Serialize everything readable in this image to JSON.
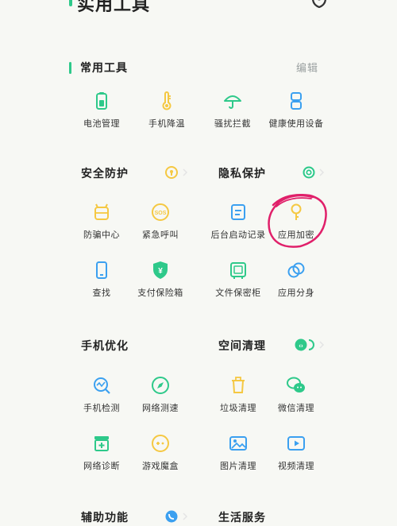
{
  "header": {
    "title": "实用工具"
  },
  "sections": {
    "common": {
      "title": "常用工具",
      "edit_label": "编辑"
    },
    "security": {
      "title": "安全防护"
    },
    "privacy": {
      "title": "隐私保护"
    },
    "optimize": {
      "title": "手机优化"
    },
    "clean": {
      "title": "空间清理"
    },
    "assist": {
      "title": "辅助功能"
    },
    "life": {
      "title": "生活服务"
    }
  },
  "tools": {
    "battery": "电池管理",
    "cooling": "手机降温",
    "block": "骚扰拦截",
    "health": "健康使用设备",
    "antifraud": "防骗中心",
    "sos": "紧急呼叫",
    "bootlog": "后台启动记录",
    "applock": "应用加密",
    "find": "查找",
    "paysafe": "支付保险箱",
    "filesafe": "文件保密柜",
    "clone": "应用分身",
    "check": "手机检测",
    "netspeed": "网络测速",
    "trash": "垃圾清理",
    "wechat": "微信清理",
    "netdiag": "网络诊断",
    "gamebox": "游戏魔盒",
    "photo": "图片清理",
    "video": "视频清理"
  },
  "colors": {
    "accent": "#2ec98a",
    "blue": "#3ba0f0",
    "yellow": "#f5c842",
    "annotation": "#e0206a"
  },
  "icons": {
    "battery": "battery-icon",
    "cooling": "thermometer-icon",
    "block": "umbrella-icon",
    "health": "hourglass-icon",
    "antifraud": "robot-icon",
    "sos": "sos-icon",
    "bootlog": "document-icon",
    "applock": "key-icon",
    "find": "phone-icon",
    "paysafe": "shield-yen-icon",
    "filesafe": "safe-icon",
    "clone": "clone-icon",
    "check": "magnifier-icon",
    "netspeed": "compass-icon",
    "trash": "trash-icon",
    "wechat": "wechat-icon",
    "netdiag": "briefcase-icon",
    "gamebox": "gamepad-icon",
    "photo": "image-icon",
    "video": "play-icon"
  }
}
